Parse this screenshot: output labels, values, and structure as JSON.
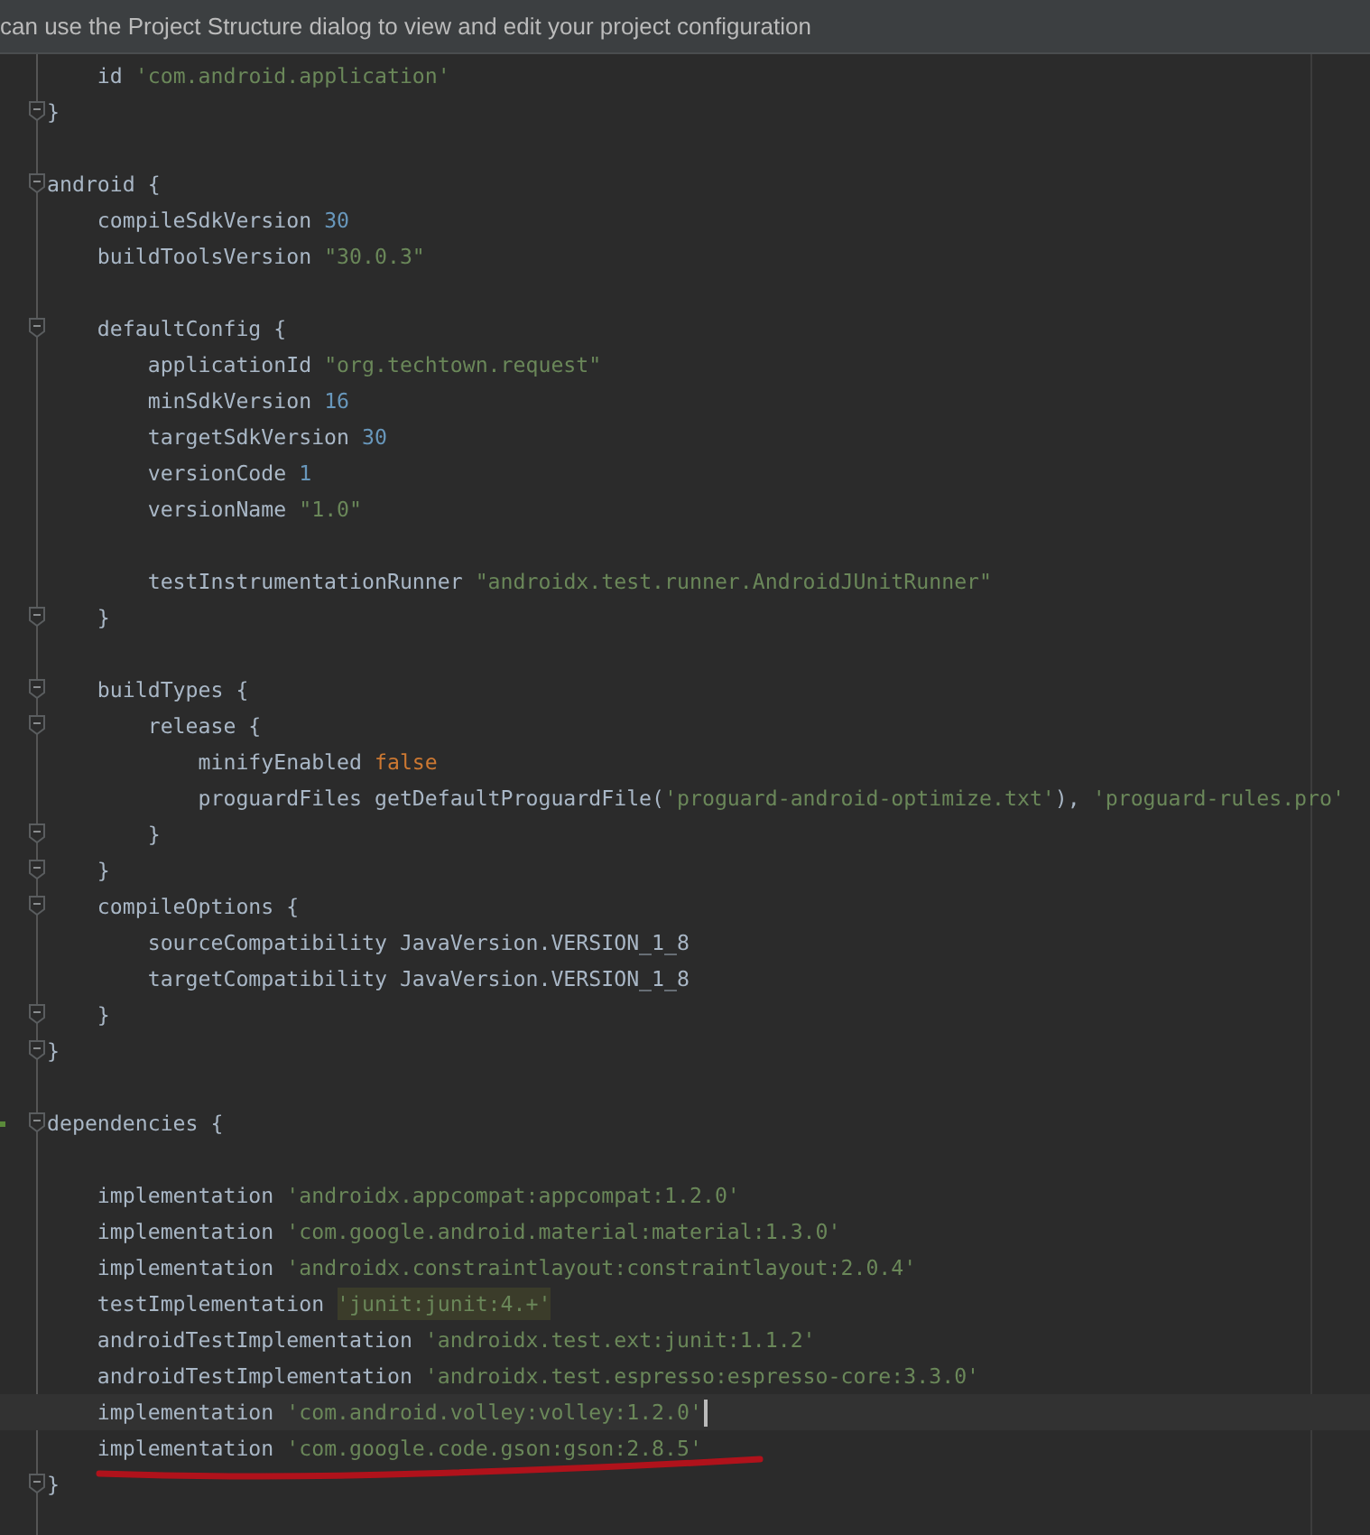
{
  "banner": {
    "text": "can use the Project Structure dialog to view and edit your project configuration"
  },
  "editor": {
    "lines": [
      {
        "fold": false,
        "segments": [
          {
            "t": "    id ",
            "kind": "plain"
          },
          {
            "t": "'com.android.application'",
            "kind": "string"
          }
        ]
      },
      {
        "fold": true,
        "segments": [
          {
            "t": "}",
            "kind": "plain"
          }
        ]
      },
      {
        "fold": false
      },
      {
        "fold": true,
        "segments": [
          {
            "t": "android {",
            "kind": "plain"
          }
        ]
      },
      {
        "fold": false,
        "segments": [
          {
            "t": "    compileSdkVersion ",
            "kind": "plain"
          },
          {
            "t": "30",
            "kind": "number"
          }
        ]
      },
      {
        "fold": false,
        "segments": [
          {
            "t": "    buildToolsVersion ",
            "kind": "plain"
          },
          {
            "t": "\"30.0.3\"",
            "kind": "string"
          }
        ]
      },
      {
        "fold": false
      },
      {
        "fold": true,
        "segments": [
          {
            "t": "    defaultConfig {",
            "kind": "plain"
          }
        ]
      },
      {
        "fold": false,
        "segments": [
          {
            "t": "        applicationId ",
            "kind": "plain"
          },
          {
            "t": "\"org.techtown.request\"",
            "kind": "string"
          }
        ]
      },
      {
        "fold": false,
        "segments": [
          {
            "t": "        minSdkVersion ",
            "kind": "plain"
          },
          {
            "t": "16",
            "kind": "number"
          }
        ]
      },
      {
        "fold": false,
        "segments": [
          {
            "t": "        targetSdkVersion ",
            "kind": "plain"
          },
          {
            "t": "30",
            "kind": "number"
          }
        ]
      },
      {
        "fold": false,
        "segments": [
          {
            "t": "        versionCode ",
            "kind": "plain"
          },
          {
            "t": "1",
            "kind": "number"
          }
        ]
      },
      {
        "fold": false,
        "segments": [
          {
            "t": "        versionName ",
            "kind": "plain"
          },
          {
            "t": "\"1.0\"",
            "kind": "string"
          }
        ]
      },
      {
        "fold": false
      },
      {
        "fold": false,
        "segments": [
          {
            "t": "        testInstrumentationRunner ",
            "kind": "plain"
          },
          {
            "t": "\"androidx.test.runner.AndroidJUnitRunner\"",
            "kind": "string"
          }
        ]
      },
      {
        "fold": true,
        "segments": [
          {
            "t": "    }",
            "kind": "plain"
          }
        ]
      },
      {
        "fold": false
      },
      {
        "fold": true,
        "segments": [
          {
            "t": "    buildTypes {",
            "kind": "plain"
          }
        ]
      },
      {
        "fold": true,
        "segments": [
          {
            "t": "        release {",
            "kind": "plain"
          }
        ]
      },
      {
        "fold": false,
        "segments": [
          {
            "t": "            minifyEnabled ",
            "kind": "plain"
          },
          {
            "t": "false",
            "kind": "keyword"
          }
        ]
      },
      {
        "fold": false,
        "segments": [
          {
            "t": "            proguardFiles getDefaultProguardFile(",
            "kind": "plain"
          },
          {
            "t": "'proguard-android-optimize.txt'",
            "kind": "string"
          },
          {
            "t": "), ",
            "kind": "plain"
          },
          {
            "t": "'proguard-rules.pro'",
            "kind": "string"
          }
        ]
      },
      {
        "fold": true,
        "segments": [
          {
            "t": "        }",
            "kind": "plain"
          }
        ]
      },
      {
        "fold": true,
        "segments": [
          {
            "t": "    }",
            "kind": "plain"
          }
        ]
      },
      {
        "fold": true,
        "segments": [
          {
            "t": "    compileOptions {",
            "kind": "plain"
          }
        ]
      },
      {
        "fold": false,
        "segments": [
          {
            "t": "        sourceCompatibility JavaVersion.VERSION_1_8",
            "kind": "plain"
          }
        ]
      },
      {
        "fold": false,
        "segments": [
          {
            "t": "        targetCompatibility JavaVersion.VERSION_1_8",
            "kind": "plain"
          }
        ]
      },
      {
        "fold": true,
        "segments": [
          {
            "t": "    }",
            "kind": "plain"
          }
        ]
      },
      {
        "fold": true,
        "segments": [
          {
            "t": "}",
            "kind": "plain"
          }
        ]
      },
      {
        "fold": false
      },
      {
        "fold": true,
        "modified": true,
        "segments": [
          {
            "t": "dependencies {",
            "kind": "plain"
          }
        ]
      },
      {
        "fold": false
      },
      {
        "fold": false,
        "segments": [
          {
            "t": "    implementation ",
            "kind": "plain"
          },
          {
            "t": "'androidx.appcompat:appcompat:1.2.0'",
            "kind": "string"
          }
        ]
      },
      {
        "fold": false,
        "segments": [
          {
            "t": "    implementation ",
            "kind": "plain"
          },
          {
            "t": "'com.google.android.material:material:1.3.0'",
            "kind": "string"
          }
        ]
      },
      {
        "fold": false,
        "segments": [
          {
            "t": "    implementation ",
            "kind": "plain"
          },
          {
            "t": "'androidx.constraintlayout:constraintlayout:2.0.4'",
            "kind": "string"
          }
        ]
      },
      {
        "fold": false,
        "segments": [
          {
            "t": "    testImplementation ",
            "kind": "plain"
          },
          {
            "t": "'junit:junit:4.+'",
            "kind": "highlight"
          }
        ]
      },
      {
        "fold": false,
        "segments": [
          {
            "t": "    androidTestImplementation ",
            "kind": "plain"
          },
          {
            "t": "'androidx.test.ext:junit:1.1.2'",
            "kind": "string"
          }
        ]
      },
      {
        "fold": false,
        "segments": [
          {
            "t": "    androidTestImplementation ",
            "kind": "plain"
          },
          {
            "t": "'androidx.test.espresso:espresso-core:3.3.0'",
            "kind": "string"
          }
        ]
      },
      {
        "fold": false,
        "current": true,
        "segments": [
          {
            "t": "    implementation ",
            "kind": "plain"
          },
          {
            "t": "'com.android.volley:volley:1.2.0'",
            "kind": "string"
          }
        ]
      },
      {
        "fold": false,
        "scribbled": true,
        "segments": [
          {
            "t": "    implementation ",
            "kind": "plain"
          },
          {
            "t": "'com.google.code.gson:gson:2.8.5'",
            "kind": "string"
          }
        ]
      },
      {
        "fold": true,
        "segments": [
          {
            "t": "}",
            "kind": "plain"
          }
        ]
      }
    ]
  }
}
